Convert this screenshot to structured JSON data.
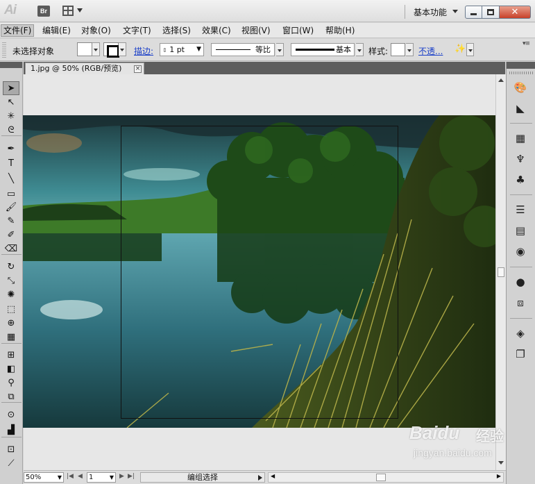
{
  "app": {
    "logo": "Ai",
    "bridge_button": "Br",
    "workspace": "基本功能"
  },
  "menu": [
    "文件(F)",
    "编辑(E)",
    "对象(O)",
    "文字(T)",
    "选择(S)",
    "效果(C)",
    "视图(V)",
    "窗口(W)",
    "帮助(H)"
  ],
  "control": {
    "status": "未选择对象",
    "stroke_label": "描边:",
    "stroke_weight": "1 pt",
    "profile_label": "等比",
    "brush_label": "基本",
    "style_label": "样式:",
    "opacity_link": "不透..."
  },
  "document": {
    "tab_title": "1.jpg @ 50% (RGB/预览)",
    "tab_close": "×"
  },
  "statusbar": {
    "zoom": "50%",
    "artboard": "1",
    "tool_status": "编组选择"
  },
  "tools": [
    {
      "icon": "selection-icon",
      "glyph": "➤",
      "selected": true
    },
    {
      "icon": "direct-selection-icon",
      "glyph": "↖"
    },
    {
      "icon": "magic-wand-icon",
      "glyph": "✳"
    },
    {
      "icon": "lasso-icon",
      "glyph": "ᘓ"
    },
    {
      "icon": "pen-icon",
      "glyph": "✒"
    },
    {
      "icon": "type-icon",
      "glyph": "T"
    },
    {
      "icon": "line-segment-icon",
      "glyph": "╲"
    },
    {
      "icon": "rectangle-icon",
      "glyph": "▭"
    },
    {
      "icon": "paintbrush-icon",
      "glyph": "🖌"
    },
    {
      "icon": "pencil-icon",
      "glyph": "✎"
    },
    {
      "icon": "blob-brush-icon",
      "glyph": "✐"
    },
    {
      "icon": "eraser-icon",
      "glyph": "⌫"
    },
    {
      "icon": "rotate-icon",
      "glyph": "↻"
    },
    {
      "icon": "scale-icon",
      "glyph": "⤡"
    },
    {
      "icon": "warp-icon",
      "glyph": "✺"
    },
    {
      "icon": "free-transform-icon",
      "glyph": "⬚"
    },
    {
      "icon": "shape-builder-icon",
      "glyph": "⊕"
    },
    {
      "icon": "perspective-grid-icon",
      "glyph": "▦"
    },
    {
      "icon": "mesh-icon",
      "glyph": "⊞"
    },
    {
      "icon": "gradient-icon",
      "glyph": "◧"
    },
    {
      "icon": "eyedropper-icon",
      "glyph": "⚲"
    },
    {
      "icon": "blend-icon",
      "glyph": "⧉"
    },
    {
      "icon": "symbol-sprayer-icon",
      "glyph": "⊙"
    },
    {
      "icon": "column-graph-icon",
      "glyph": "▟"
    },
    {
      "icon": "artboard-icon",
      "glyph": "⊡"
    },
    {
      "icon": "slice-icon",
      "glyph": "⟋"
    }
  ],
  "dock": [
    {
      "icon": "color-palette-icon",
      "glyph": "🎨"
    },
    {
      "icon": "color-guide-icon",
      "glyph": "◣"
    },
    {
      "icon": "swatches-icon",
      "glyph": "▦"
    },
    {
      "icon": "brushes-icon",
      "glyph": "♆"
    },
    {
      "icon": "symbols-icon",
      "glyph": "♣"
    },
    {
      "icon": "stroke-icon",
      "glyph": "☰"
    },
    {
      "icon": "gradient-panel-icon",
      "glyph": "▤"
    },
    {
      "icon": "transparency-icon",
      "glyph": "◉"
    },
    {
      "icon": "appearance-icon",
      "glyph": "●"
    },
    {
      "icon": "graphic-styles-icon",
      "glyph": "⧈"
    },
    {
      "icon": "layers-icon",
      "glyph": "◈"
    },
    {
      "icon": "artboards-panel-icon",
      "glyph": "❐"
    }
  ],
  "watermark": {
    "brand": "Baidu",
    "brand_cn": "经验",
    "url": "jingyan.baidu.com"
  }
}
